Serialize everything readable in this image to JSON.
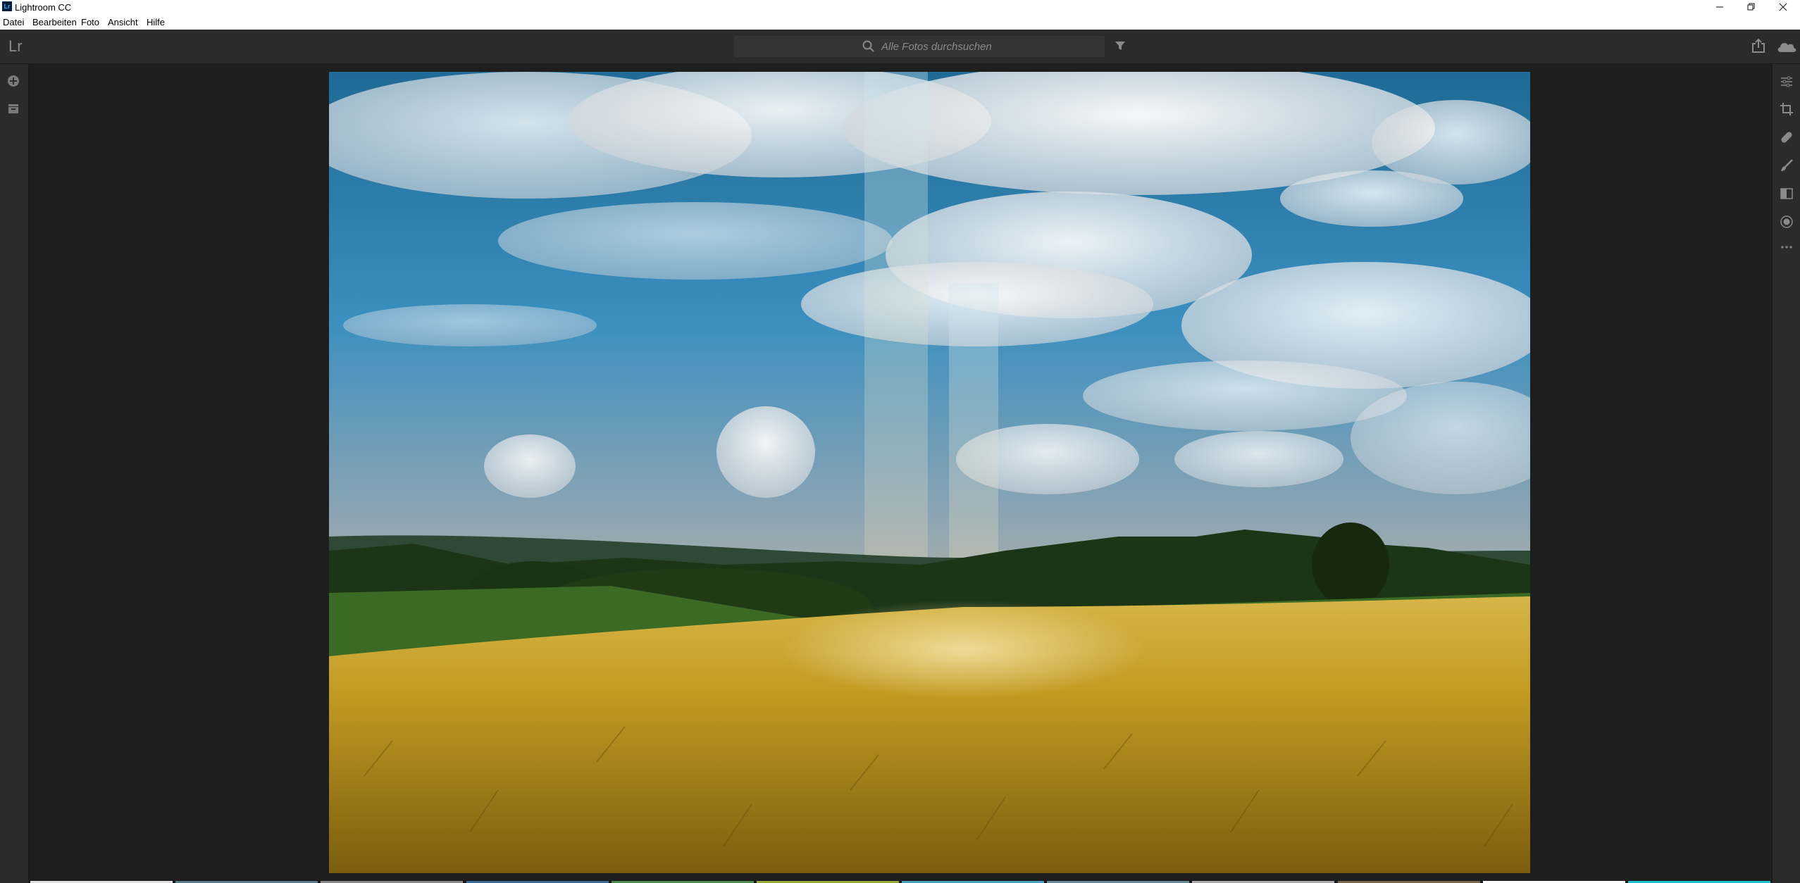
{
  "window": {
    "title": "Lightroom CC",
    "app_icon_text": "Lr"
  },
  "menu": {
    "items": [
      "Datei",
      "Bearbeiten",
      "Foto",
      "Ansicht",
      "Hilfe"
    ]
  },
  "toolbar": {
    "logo": "Lr",
    "search_placeholder": "Alle Fotos durchsuchen"
  },
  "left_panel": {
    "icons": [
      "add-photos-icon",
      "library-icon"
    ]
  },
  "right_panel": {
    "icons": [
      "edit-sliders-icon",
      "crop-icon",
      "healing-icon",
      "brush-icon",
      "linear-gradient-icon",
      "radial-gradient-icon",
      "more-icon"
    ]
  },
  "photo": {
    "subject": "landscape",
    "colors": {
      "sky": "#2a7fb0",
      "cloud": "#e8ebee",
      "field": "#c39a1e",
      "trees": "#1d3a14"
    }
  },
  "filmstrip": {
    "thumb_colors": [
      "#e0e0e0",
      "#5a7a8a",
      "#888888",
      "#3a6a9a",
      "#4a8a4a",
      "#9aaa3a",
      "#4aa0c0",
      "#6a8a9a",
      "#aaaaaa",
      "#7a6a4a",
      "#ffffff",
      "#20c0d0"
    ]
  }
}
